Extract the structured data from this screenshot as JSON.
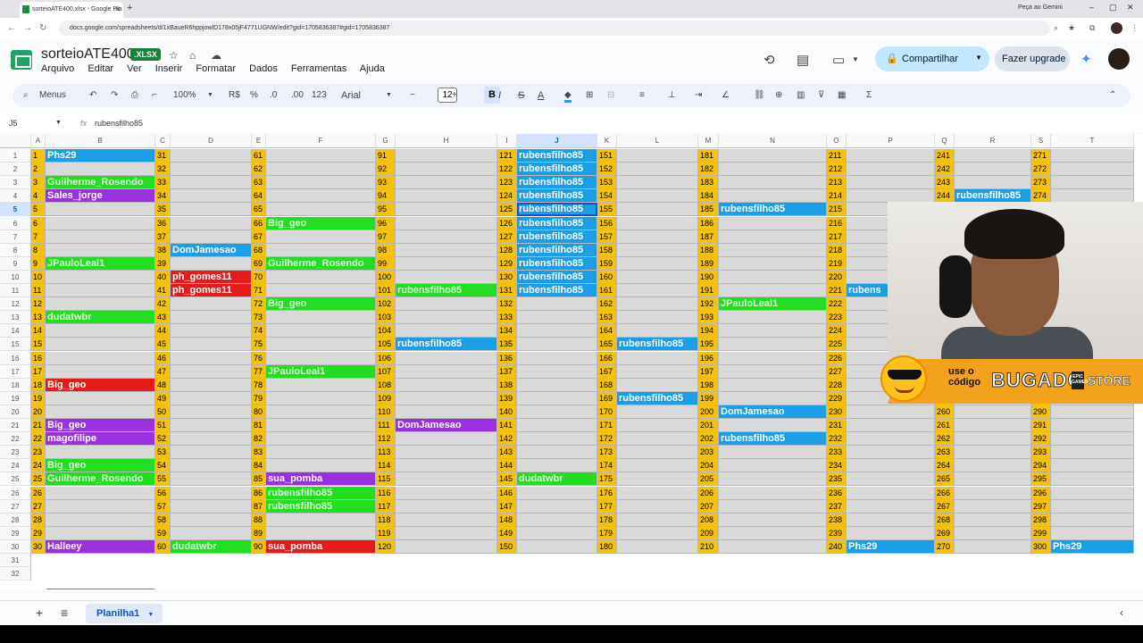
{
  "browser": {
    "tab_title": "sorteioATE400.xlsx - Google Pla",
    "new_tab": "+",
    "gemini": "Peça ao Gemini",
    "url": "docs.google.com/spreadsheets/d/1xBaueR6hppjowlD178x05jF4771UGNW/edit?gid=1705836387#gid=1705836387"
  },
  "header": {
    "doc_title": "sorteioATE400",
    "badge": ".XLSX",
    "menus": [
      "Arquivo",
      "Editar",
      "Ver",
      "Inserir",
      "Formatar",
      "Dados",
      "Ferramentas",
      "Ajuda"
    ],
    "share": "Compartilhar",
    "upgrade": "Fazer upgrade"
  },
  "toolbar": {
    "search": "Menus",
    "zoom": "100%",
    "currency": "R$",
    "percent": "%",
    "dec_less": ".0",
    "dec_more": ".00",
    "number_fmt": "123",
    "font": "Arial",
    "font_size": "12",
    "bold": "B",
    "italic": "I",
    "strike": "S",
    "text_color": "A",
    "sum": "Σ"
  },
  "formula": {
    "cell_ref": "J5",
    "fx": "fx",
    "value": "rubensfilho85"
  },
  "grid": {
    "selected_col": "J",
    "selected_row": 5,
    "columns": [
      "A",
      "B",
      "C",
      "D",
      "E",
      "F",
      "G",
      "H",
      "I",
      "J",
      "K",
      "L",
      "M",
      "N",
      "O",
      "P",
      "Q",
      "R",
      "S",
      "T"
    ],
    "row_numbers": [
      1,
      2,
      3,
      4,
      5,
      6,
      7,
      8,
      9,
      10,
      11,
      12,
      13,
      14,
      15,
      16,
      17,
      18,
      19,
      20,
      21,
      22,
      23,
      24,
      25,
      26,
      27,
      28,
      29,
      30,
      31,
      32
    ],
    "blocks": [
      {
        "num_col": 0,
        "name_col": 1,
        "start": 1
      },
      {
        "num_col": 2,
        "name_col": 3,
        "start": 31
      },
      {
        "num_col": 4,
        "name_col": 5,
        "start": 61
      },
      {
        "num_col": 6,
        "name_col": 7,
        "start": 91
      },
      {
        "num_col": 8,
        "name_col": 9,
        "start": 121
      },
      {
        "num_col": 10,
        "name_col": 11,
        "start": 151
      },
      {
        "num_col": 12,
        "name_col": 13,
        "start": 181
      },
      {
        "num_col": 14,
        "name_col": 15,
        "start": 211
      },
      {
        "num_col": 16,
        "name_col": 17,
        "start": 241
      },
      {
        "num_col": 18,
        "name_col": 19,
        "start": 271
      }
    ],
    "names": [
      {
        "col": 1,
        "row": 1,
        "text": "Phs29",
        "color": "#1a9ee8"
      },
      {
        "col": 1,
        "row": 3,
        "text": "Guilherme_Rosendo",
        "color": "#22dd22"
      },
      {
        "col": 1,
        "row": 4,
        "text": "Sales_jorge",
        "color": "#9b30e0"
      },
      {
        "col": 1,
        "row": 9,
        "text": "JPauloLeal1",
        "color": "#22dd22"
      },
      {
        "col": 1,
        "row": 13,
        "text": "dudatwbr",
        "color": "#22dd22"
      },
      {
        "col": 1,
        "row": 18,
        "text": "Big_geo",
        "color": "#e51b1b"
      },
      {
        "col": 1,
        "row": 21,
        "text": "Big_geo",
        "color": "#9b30e0"
      },
      {
        "col": 1,
        "row": 22,
        "text": "magofilipe",
        "color": "#9b30e0"
      },
      {
        "col": 1,
        "row": 24,
        "text": "Big_geo",
        "color": "#22dd22"
      },
      {
        "col": 1,
        "row": 25,
        "text": "Guilherme_Rosendo",
        "color": "#22dd22"
      },
      {
        "col": 1,
        "row": 30,
        "text": "Halleey",
        "color": "#9b30e0"
      },
      {
        "col": 3,
        "row": 8,
        "text": "DomJamesao",
        "color": "#1a9ee8"
      },
      {
        "col": 3,
        "row": 10,
        "text": "ph_gomes11",
        "color": "#e51b1b"
      },
      {
        "col": 3,
        "row": 11,
        "text": "ph_gomes11",
        "color": "#e51b1b"
      },
      {
        "col": 3,
        "row": 30,
        "text": "dudatwbr",
        "color": "#22dd22"
      },
      {
        "col": 5,
        "row": 6,
        "text": "Big_geo",
        "color": "#22dd22"
      },
      {
        "col": 5,
        "row": 9,
        "text": "Guilherme_Rosendo",
        "color": "#22dd22"
      },
      {
        "col": 5,
        "row": 12,
        "text": "Big_geo",
        "color": "#22dd22"
      },
      {
        "col": 5,
        "row": 17,
        "text": "JPauloLeal1",
        "color": "#22dd22"
      },
      {
        "col": 5,
        "row": 25,
        "text": "sua_pomba",
        "color": "#9b30e0"
      },
      {
        "col": 5,
        "row": 26,
        "text": "rubensfilho85",
        "color": "#22dd22"
      },
      {
        "col": 5,
        "row": 27,
        "text": "rubensfilho85",
        "color": "#22dd22"
      },
      {
        "col": 5,
        "row": 30,
        "text": "sua_pomba",
        "color": "#e51b1b"
      },
      {
        "col": 7,
        "row": 11,
        "text": "rubensfilho85",
        "color": "#22dd22"
      },
      {
        "col": 7,
        "row": 15,
        "text": "rubensfilho85",
        "color": "#1a9ee8"
      },
      {
        "col": 7,
        "row": 21,
        "text": "DomJamesao",
        "color": "#9b30e0"
      },
      {
        "col": 9,
        "row": 1,
        "text": "rubensfilho85",
        "color": "#1a9ee8"
      },
      {
        "col": 9,
        "row": 2,
        "text": "rubensfilho85",
        "color": "#1a9ee8"
      },
      {
        "col": 9,
        "row": 3,
        "text": "rubensfilho85",
        "color": "#1a9ee8"
      },
      {
        "col": 9,
        "row": 4,
        "text": "rubensfilho85",
        "color": "#1a9ee8"
      },
      {
        "col": 9,
        "row": 5,
        "text": "rubensfilho85",
        "color": "#1a9ee8"
      },
      {
        "col": 9,
        "row": 6,
        "text": "rubensfilho85",
        "color": "#1a9ee8"
      },
      {
        "col": 9,
        "row": 7,
        "text": "rubensfilho85",
        "color": "#1a9ee8"
      },
      {
        "col": 9,
        "row": 8,
        "text": "rubensfilho85",
        "color": "#1a9ee8"
      },
      {
        "col": 9,
        "row": 9,
        "text": "rubensfilho85",
        "color": "#1a9ee8"
      },
      {
        "col": 9,
        "row": 10,
        "text": "rubensfilho85",
        "color": "#1a9ee8"
      },
      {
        "col": 9,
        "row": 11,
        "text": "rubensfilho85",
        "color": "#1a9ee8"
      },
      {
        "col": 9,
        "row": 25,
        "text": "dudatwbr",
        "color": "#22dd22"
      },
      {
        "col": 11,
        "row": 15,
        "text": "rubensfilho85",
        "color": "#1a9ee8"
      },
      {
        "col": 11,
        "row": 19,
        "text": "rubensfilho85",
        "color": "#1a9ee8"
      },
      {
        "col": 13,
        "row": 5,
        "text": "rubensfilho85",
        "color": "#1a9ee8"
      },
      {
        "col": 13,
        "row": 12,
        "text": "JPauloLeal1",
        "color": "#22dd22"
      },
      {
        "col": 13,
        "row": 20,
        "text": "DomJamesao",
        "color": "#1a9ee8"
      },
      {
        "col": 13,
        "row": 22,
        "text": "rubensfilho85",
        "color": "#1a9ee8"
      },
      {
        "col": 15,
        "row": 11,
        "text": "rubens",
        "color": "#1a9ee8"
      },
      {
        "col": 15,
        "row": 30,
        "text": "Phs29",
        "color": "#1a9ee8"
      },
      {
        "col": 17,
        "row": 4,
        "text": "rubensfilho85",
        "color": "#1a9ee8"
      },
      {
        "col": 19,
        "row": 30,
        "text": "Phs29",
        "color": "#1a9ee8"
      }
    ]
  },
  "bottom": {
    "add": "+",
    "list": "≡",
    "sheet_tab": "Planilha1"
  },
  "overlay": {
    "promo_line1": "use o",
    "promo_line2": "código",
    "brand": "BUGADO",
    "epic": "EPIC GAMES",
    "store": "STORE"
  },
  "colors": {
    "number_cell": "#f4c20d",
    "empty_cell": "#d9d9d9",
    "green_text": "#d7ffd0",
    "accent": "#0b57d0"
  }
}
